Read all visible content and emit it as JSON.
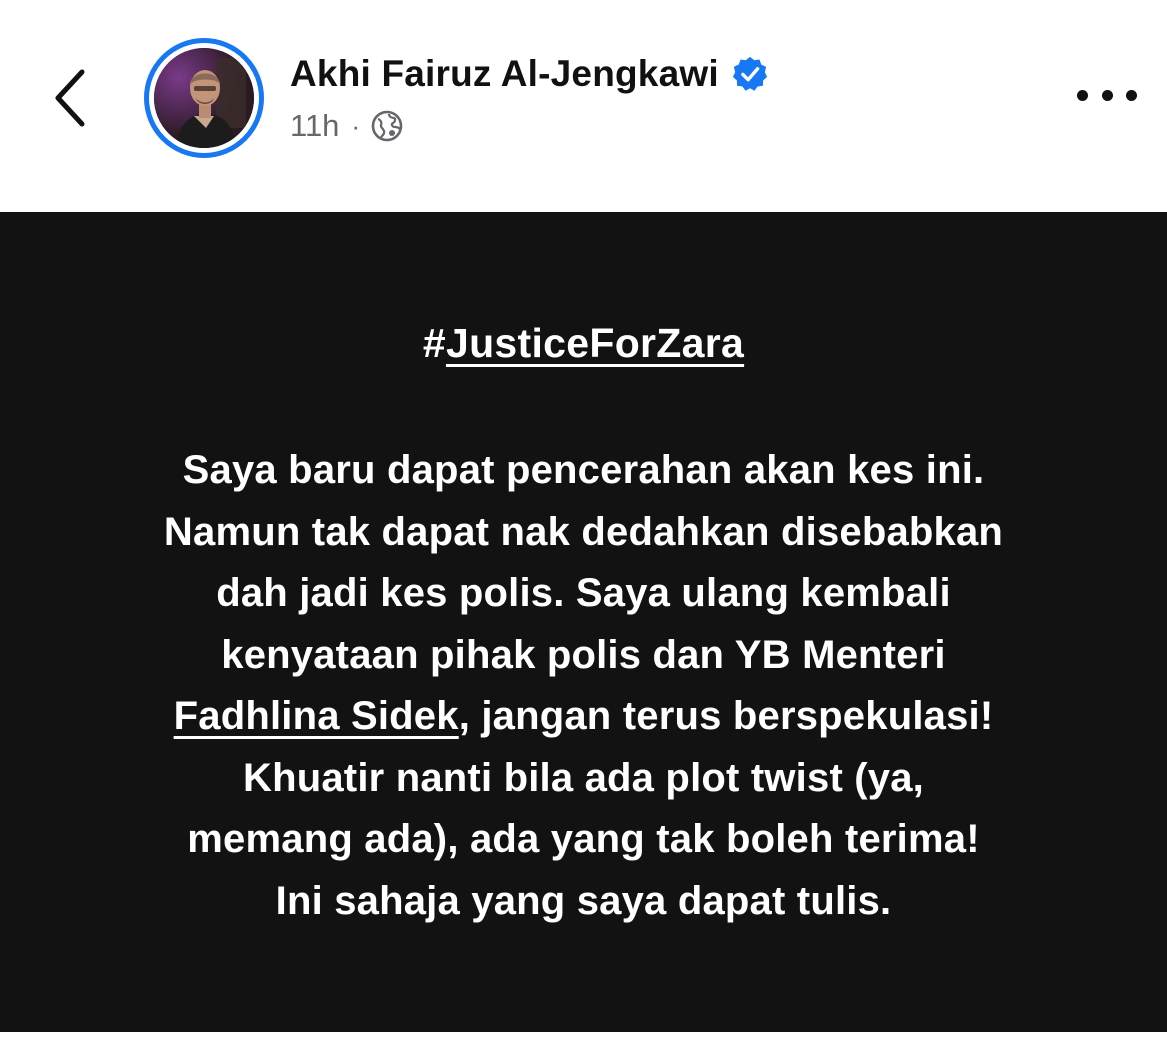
{
  "header": {
    "back_icon": "chevron-left-icon",
    "author_name": "Akhi Fairuz Al-Jengkawi",
    "verified_icon": "verified-badge-icon",
    "timestamp": "11h",
    "separator": "·",
    "audience_icon": "globe-icon",
    "more_icon": "more-horizontal-icon",
    "accent_color": "#1877f2"
  },
  "post": {
    "background_color": "#121212",
    "hashtag_prefix": "#",
    "hashtag_text": "JusticeForZara",
    "lines": {
      "l1": "Saya baru dapat pencerahan akan kes ini.",
      "l2": "Namun tak dapat nak dedahkan disebabkan",
      "l3": "dah jadi kes polis. Saya ulang kembali",
      "l4": "kenyataan pihak polis dan YB Menteri",
      "l5_mention": "Fadhlina Sidek",
      "l5_rest": ", jangan terus berspekulasi!",
      "l6": "Khuatir nanti bila ada plot twist (ya,",
      "l7": "memang ada), ada yang tak boleh terima!",
      "l8": "Ini sahaja yang saya dapat tulis."
    }
  }
}
